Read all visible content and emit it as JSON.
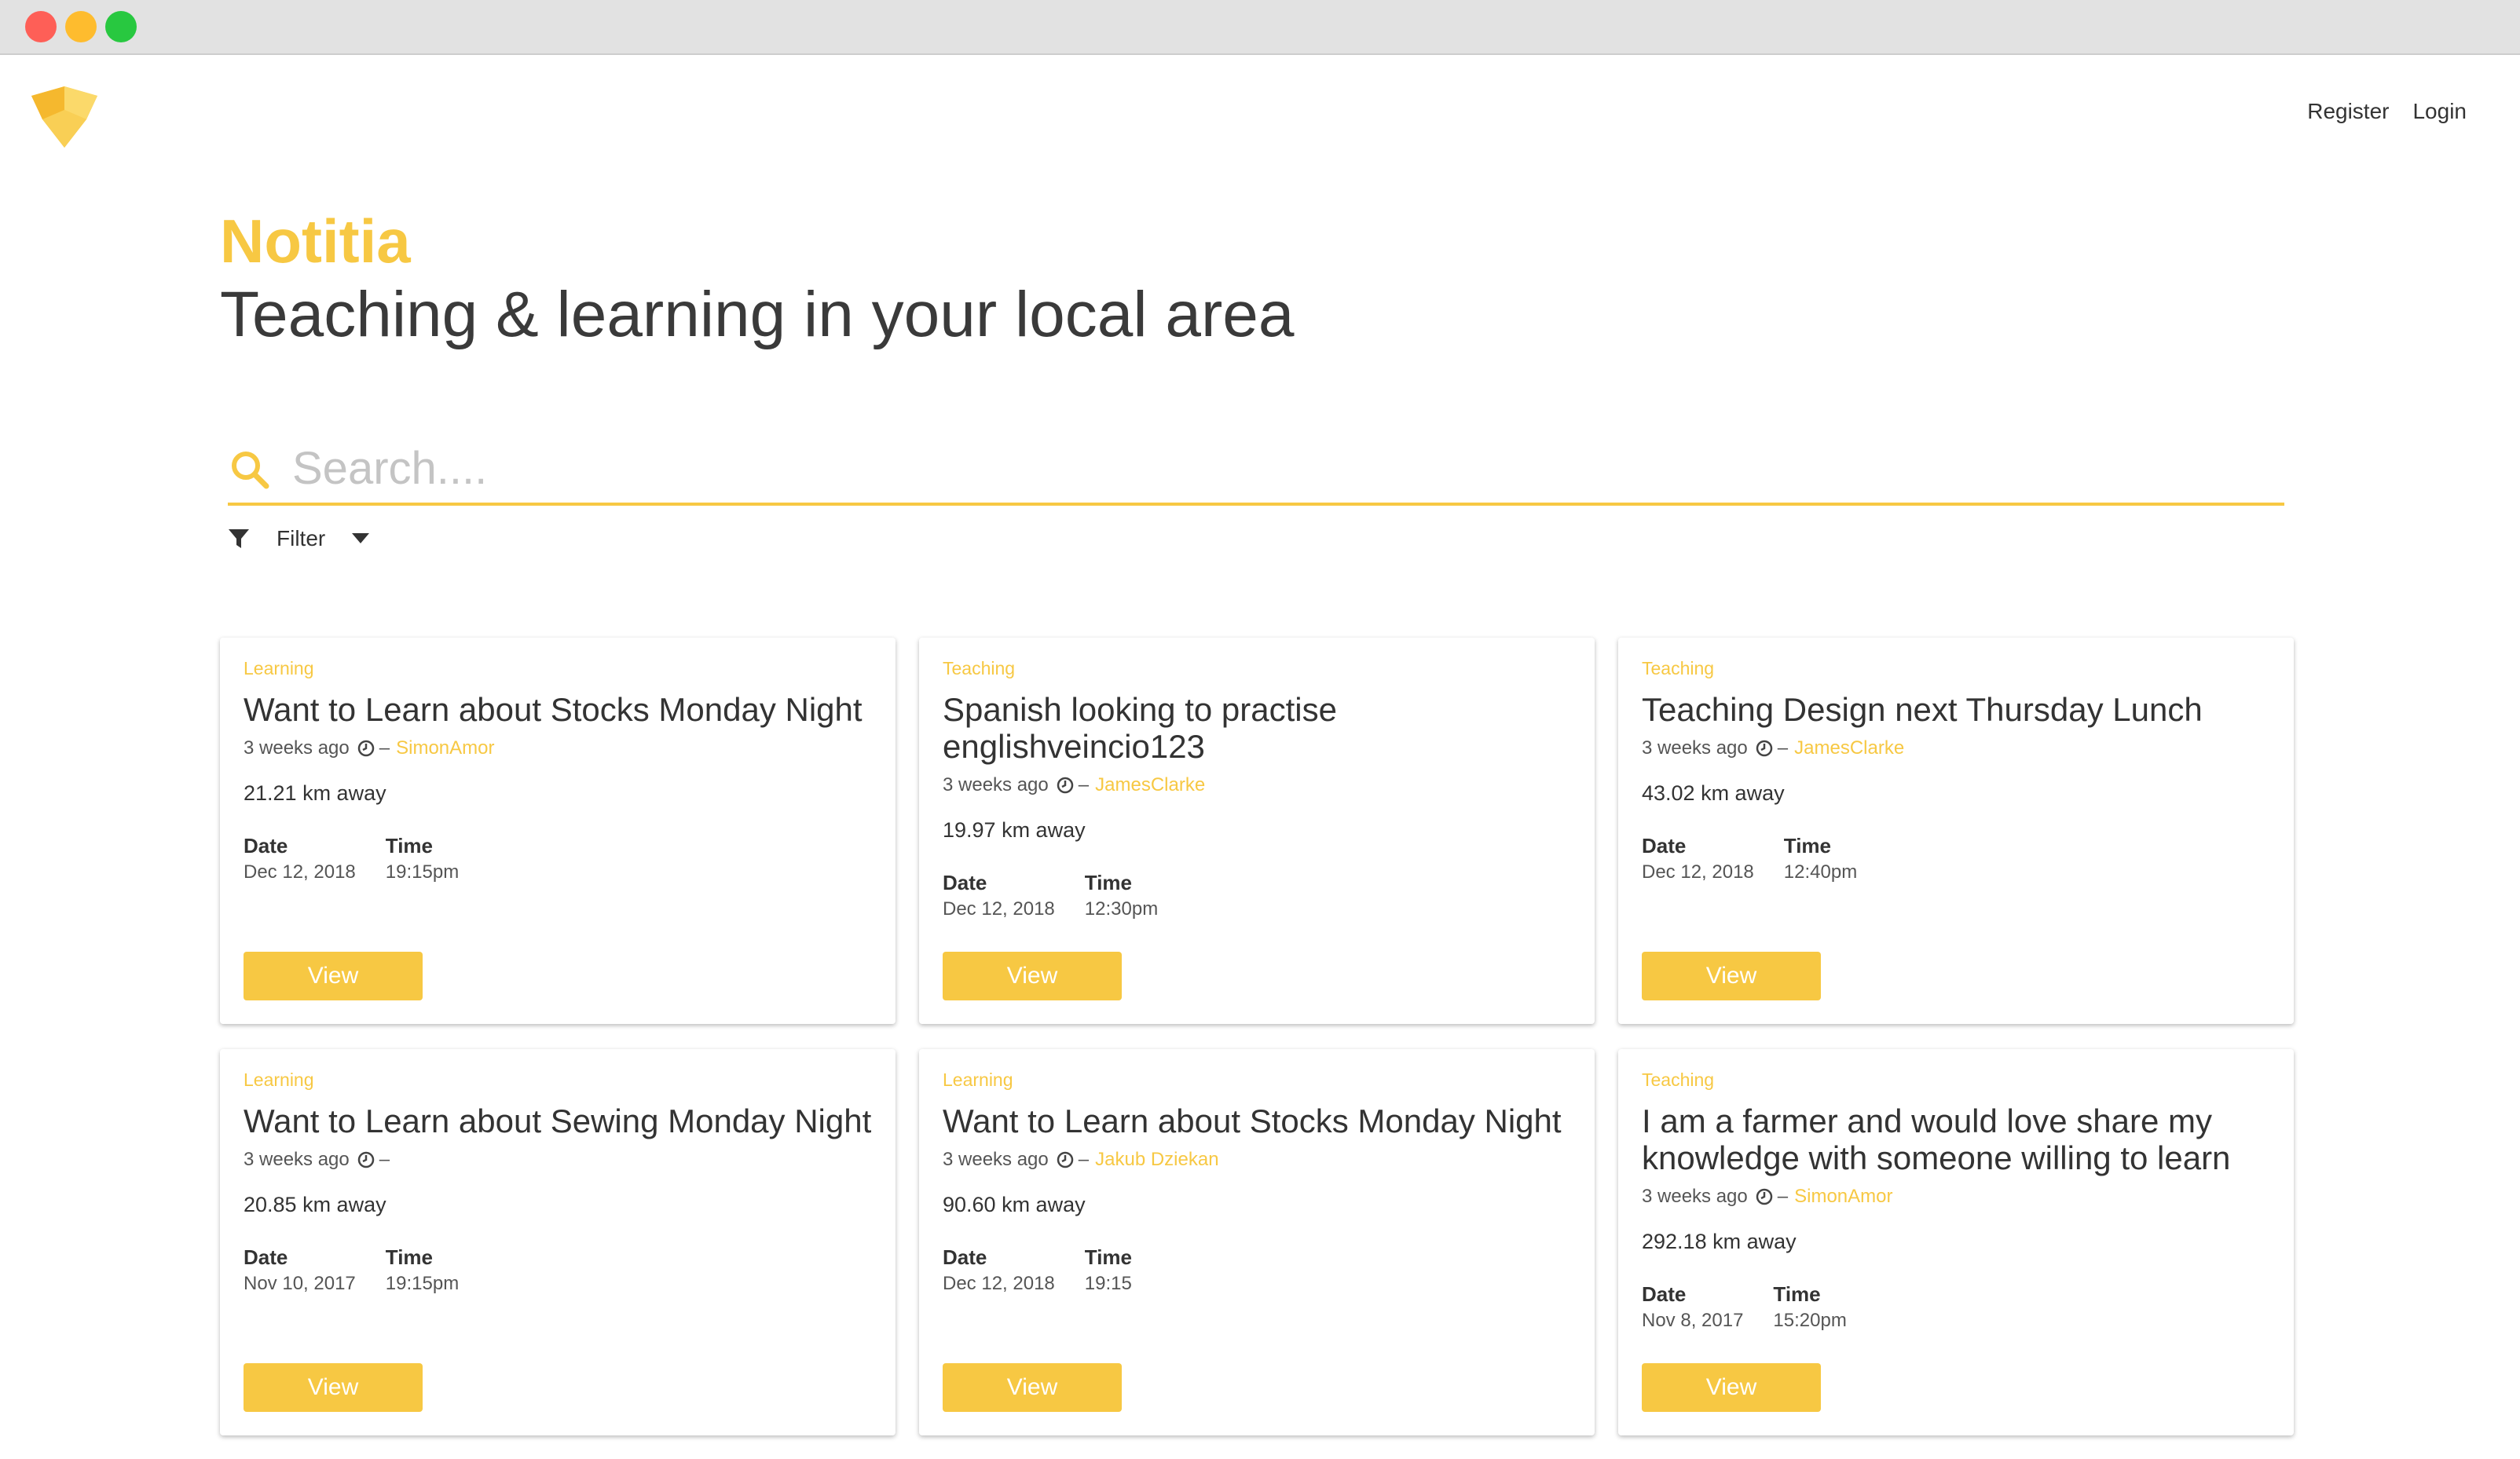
{
  "nav": {
    "register_label": "Register",
    "login_label": "Login"
  },
  "hero": {
    "brand": "Notitia",
    "tagline": "Teaching & learning in your local area"
  },
  "search": {
    "placeholder": "Search...."
  },
  "filter": {
    "label": "Filter"
  },
  "cards": [
    {
      "category": "Learning",
      "title": "Want to Learn about Stocks Monday Night",
      "posted": "3 weeks ago",
      "author": "SimonAmor",
      "distance": "21.21 km away",
      "date_label": "Date",
      "date": "Dec 12, 2018",
      "time_label": "Time",
      "time": "19:15pm",
      "button": "View"
    },
    {
      "category": "Teaching",
      "title": "Spanish looking to practise englishveincio123",
      "posted": "3 weeks ago",
      "author": "JamesClarke",
      "distance": "19.97 km away",
      "date_label": "Date",
      "date": "Dec 12, 2018",
      "time_label": "Time",
      "time": "12:30pm",
      "button": "View"
    },
    {
      "category": "Teaching",
      "title": "Teaching Design next Thursday Lunch",
      "posted": "3 weeks ago",
      "author": "JamesClarke",
      "distance": "43.02 km away",
      "date_label": "Date",
      "date": "Dec 12, 2018",
      "time_label": "Time",
      "time": "12:40pm",
      "button": "View"
    },
    {
      "category": "Learning",
      "title": "Want to Learn about Sewing Monday Night",
      "posted": "3 weeks ago",
      "author": "",
      "distance": "20.85 km away",
      "date_label": "Date",
      "date": "Nov 10, 2017",
      "time_label": "Time",
      "time": "19:15pm",
      "button": "View"
    },
    {
      "category": "Learning",
      "title": "Want to Learn about Stocks Monday Night",
      "posted": "3 weeks ago",
      "author": "Jakub Dziekan",
      "distance": "90.60 km away",
      "date_label": "Date",
      "date": "Dec 12, 2018",
      "time_label": "Time",
      "time": "19:15",
      "button": "View"
    },
    {
      "category": "Teaching",
      "title": "I am a farmer and would love share my knowledge with someone willing to learn",
      "posted": "3 weeks ago",
      "author": "SimonAmor",
      "distance": "292.18 km away",
      "date_label": "Date",
      "date": "Nov 8, 2017",
      "time_label": "Time",
      "time": "15:20pm",
      "button": "View"
    }
  ],
  "colors": {
    "accent": "#f7c843",
    "text": "#333333",
    "muted": "#555555",
    "placeholder": "#c4c4c4"
  },
  "icons": {
    "logo": "fox-book-logo",
    "search": "search-icon",
    "filter": "filter-funnel-icon",
    "caret": "caret-down-icon",
    "clock": "clock-icon"
  }
}
